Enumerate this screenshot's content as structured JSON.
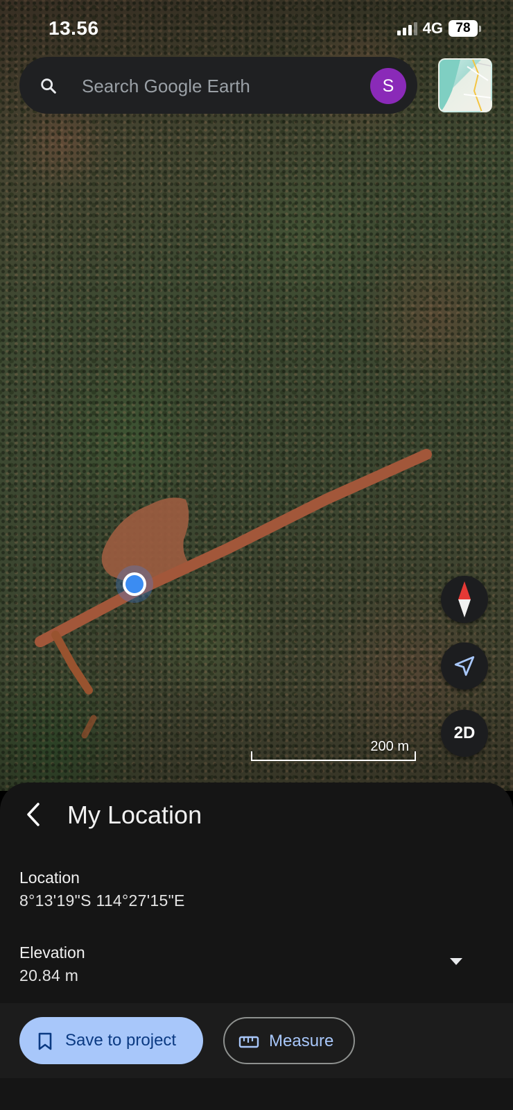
{
  "status_bar": {
    "time": "13.56",
    "network": "4G",
    "battery": "78"
  },
  "search": {
    "placeholder": "Search Google Earth",
    "avatar_initial": "S"
  },
  "map": {
    "controls": {
      "compass_icon": "compass-icon",
      "my_location_icon": "navigation-arrow-icon",
      "view_mode": "2D"
    },
    "scale_label": "200 m"
  },
  "sheet": {
    "title": "My Location",
    "location_label": "Location",
    "location_value": "8°13'19\"S 114°27'15\"E",
    "elevation_label": "Elevation",
    "elevation_value": "20.84 m"
  },
  "actions": {
    "save_label": "Save to project",
    "measure_label": "Measure"
  },
  "colors": {
    "primary_button_bg": "#a8c7fa",
    "accent_text": "#a8c7fa",
    "avatar_bg": "#8a2ab8",
    "location_dot": "#3b8cf2",
    "road": "#a2573a"
  }
}
